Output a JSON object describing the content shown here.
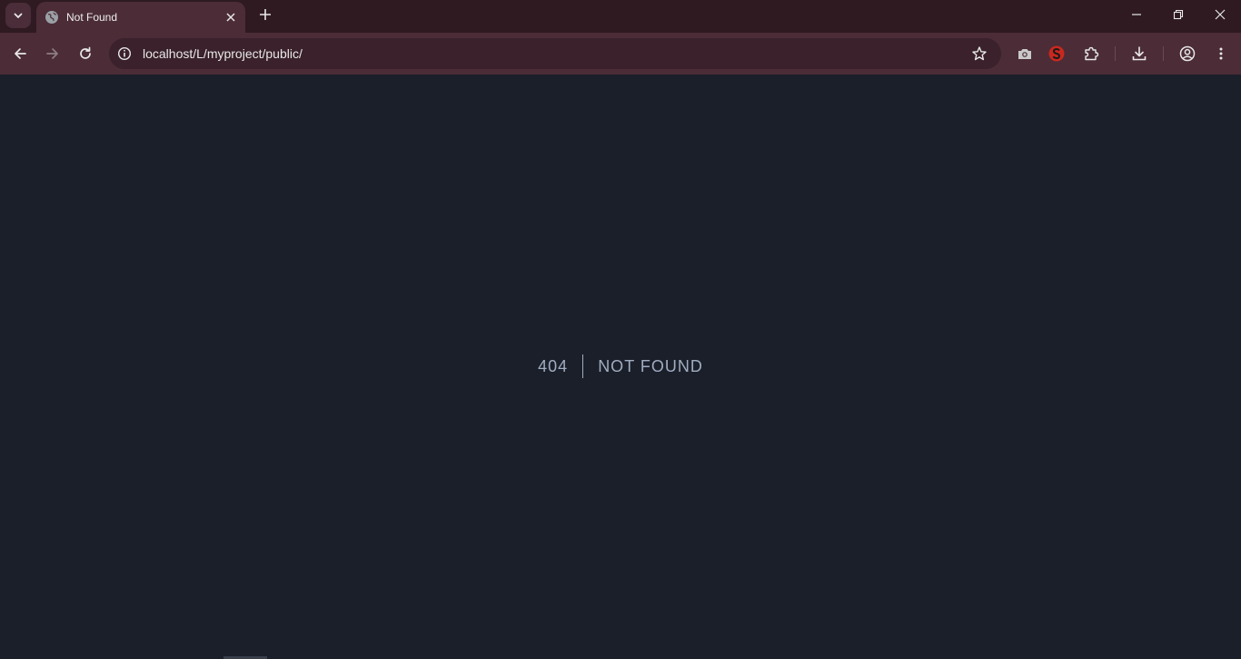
{
  "browser": {
    "tab": {
      "title": "Not Found"
    },
    "address_bar": {
      "url": "localhost/L/myproject/public/"
    },
    "colors": {
      "tabstrip": "#2f1a22",
      "toolbar": "#4b2c37",
      "omnibox": "#3a212b"
    }
  },
  "page": {
    "error_code": "404",
    "error_text": "NOT FOUND",
    "background": "#1b1f2a",
    "text_color": "#a0adc0"
  },
  "icons": {
    "tab_search": "chevron-down-icon",
    "favicon": "globe-icon",
    "tab_close": "close-icon",
    "new_tab": "plus-icon",
    "minimize": "minimize-icon",
    "restore": "restore-icon",
    "close": "close-icon",
    "back": "back-arrow-icon",
    "forward": "forward-arrow-icon",
    "reload": "reload-icon",
    "site_info": "info-icon",
    "bookmark": "star-icon",
    "screenshot": "camera-icon",
    "seo_extension": "seo-extension-icon",
    "extensions": "puzzle-icon",
    "downloads": "download-icon",
    "profile": "profile-icon",
    "menu": "kebab-menu-icon"
  }
}
